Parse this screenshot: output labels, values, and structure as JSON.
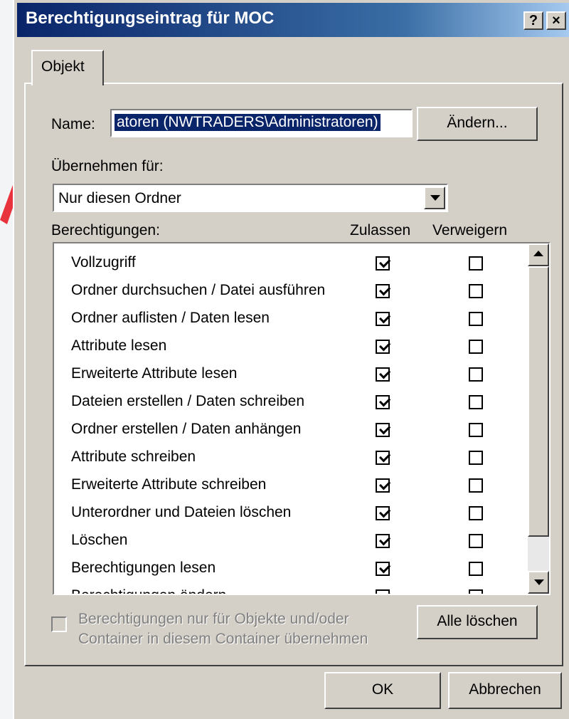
{
  "window": {
    "title": "Berechtigungseintrag für MOC",
    "help_button": "?",
    "close_button": "×"
  },
  "tabs": [
    {
      "label": "Objekt"
    }
  ],
  "name": {
    "label": "Name:",
    "value": "atoren (NWTRADERS\\Administratoren)",
    "change_button": "Ändern..."
  },
  "apply_to": {
    "label": "Übernehmen für:",
    "selected": "Nur diesen Ordner"
  },
  "permissions": {
    "label": "Berechtigungen:",
    "col_allow": "Zulassen",
    "col_deny": "Verweigern",
    "rows": [
      {
        "label": "Vollzugriff",
        "allow": true,
        "deny": false
      },
      {
        "label": "Ordner durchsuchen / Datei ausführen",
        "allow": true,
        "deny": false
      },
      {
        "label": "Ordner auflisten / Daten lesen",
        "allow": true,
        "deny": false
      },
      {
        "label": "Attribute lesen",
        "allow": true,
        "deny": false
      },
      {
        "label": "Erweiterte Attribute lesen",
        "allow": true,
        "deny": false
      },
      {
        "label": "Dateien erstellen / Daten schreiben",
        "allow": true,
        "deny": false
      },
      {
        "label": "Ordner erstellen / Daten anhängen",
        "allow": true,
        "deny": false
      },
      {
        "label": "Attribute schreiben",
        "allow": true,
        "deny": false
      },
      {
        "label": "Erweiterte Attribute schreiben",
        "allow": true,
        "deny": false
      },
      {
        "label": "Unterordner und Dateien löschen",
        "allow": true,
        "deny": false
      },
      {
        "label": "Löschen",
        "allow": true,
        "deny": false
      },
      {
        "label": "Berechtigungen lesen",
        "allow": true,
        "deny": false
      },
      {
        "label": "Berechtigungen ändern",
        "allow": true,
        "deny": false
      }
    ]
  },
  "inherit": {
    "line1": "Berechtigungen nur für Objekte und/oder",
    "line2": "Container in diesem Container übernehmen",
    "checked": false
  },
  "buttons": {
    "clear_all": "Alle löschen",
    "ok": "OK",
    "cancel": "Abbrechen"
  },
  "colors": {
    "title_start": "#0a246a",
    "title_end": "#a6caf0",
    "face": "#d4d0c8",
    "arrow": "#e8333c"
  }
}
